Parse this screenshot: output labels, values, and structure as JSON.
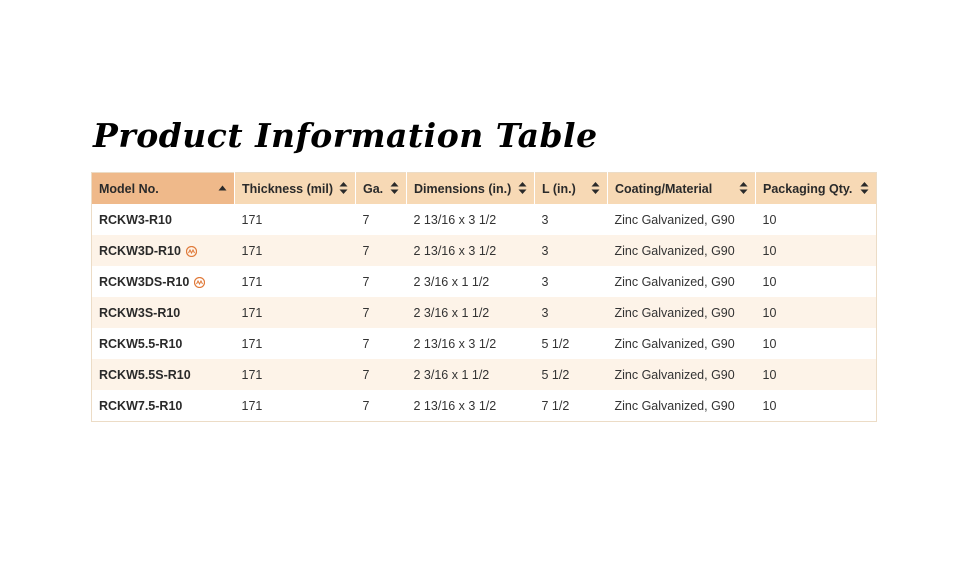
{
  "page": {
    "title": "Product Information Table"
  },
  "table": {
    "columns": [
      {
        "label": "Model No.",
        "sort": "ascending"
      },
      {
        "label": "Thickness (mil)",
        "sort": "none"
      },
      {
        "label": "Ga.",
        "sort": "none"
      },
      {
        "label": "Dimensions (in.)",
        "sort": "none"
      },
      {
        "label": "L (in.)",
        "sort": "none"
      },
      {
        "label": "Coating/Material",
        "sort": "none"
      },
      {
        "label": "Packaging Qty.",
        "sort": "none"
      }
    ],
    "rows": [
      {
        "model": "RCKW3-R10",
        "badge": false,
        "thickness": "171",
        "gauge": "7",
        "dimensions": "2 13/16 x 3 1/2",
        "length": "3",
        "coating": "Zinc Galvanized, G90",
        "qty": "10"
      },
      {
        "model": "RCKW3D-R10",
        "badge": true,
        "thickness": "171",
        "gauge": "7",
        "dimensions": "2 13/16 x 3 1/2",
        "length": "3",
        "coating": "Zinc Galvanized, G90",
        "qty": "10"
      },
      {
        "model": "RCKW3DS-R10",
        "badge": true,
        "thickness": "171",
        "gauge": "7",
        "dimensions": "2 3/16 x 1 1/2",
        "length": "3",
        "coating": "Zinc Galvanized, G90",
        "qty": "10"
      },
      {
        "model": "RCKW3S-R10",
        "badge": false,
        "thickness": "171",
        "gauge": "7",
        "dimensions": "2 3/16 x 1 1/2",
        "length": "3",
        "coating": "Zinc Galvanized, G90",
        "qty": "10"
      },
      {
        "model": "RCKW5.5-R10",
        "badge": false,
        "thickness": "171",
        "gauge": "7",
        "dimensions": "2 13/16 x 3 1/2",
        "length": "5 1/2",
        "coating": "Zinc Galvanized, G90",
        "qty": "10"
      },
      {
        "model": "RCKW5.5S-R10",
        "badge": false,
        "thickness": "171",
        "gauge": "7",
        "dimensions": "2 3/16 x 1 1/2",
        "length": "5 1/2",
        "coating": "Zinc Galvanized, G90",
        "qty": "10"
      },
      {
        "model": "RCKW7.5-R10",
        "badge": false,
        "thickness": "171",
        "gauge": "7",
        "dimensions": "2 13/16 x 3 1/2",
        "length": "7 1/2",
        "coating": "Zinc Galvanized, G90",
        "qty": "10"
      }
    ],
    "badge_icon": "seismic-badge-icon",
    "colors": {
      "header_bg": "#f7d9b5",
      "header_sorted_bg": "#efb98a",
      "row_alt_bg": "#fdf3e8",
      "badge": "#e07a3a"
    }
  }
}
